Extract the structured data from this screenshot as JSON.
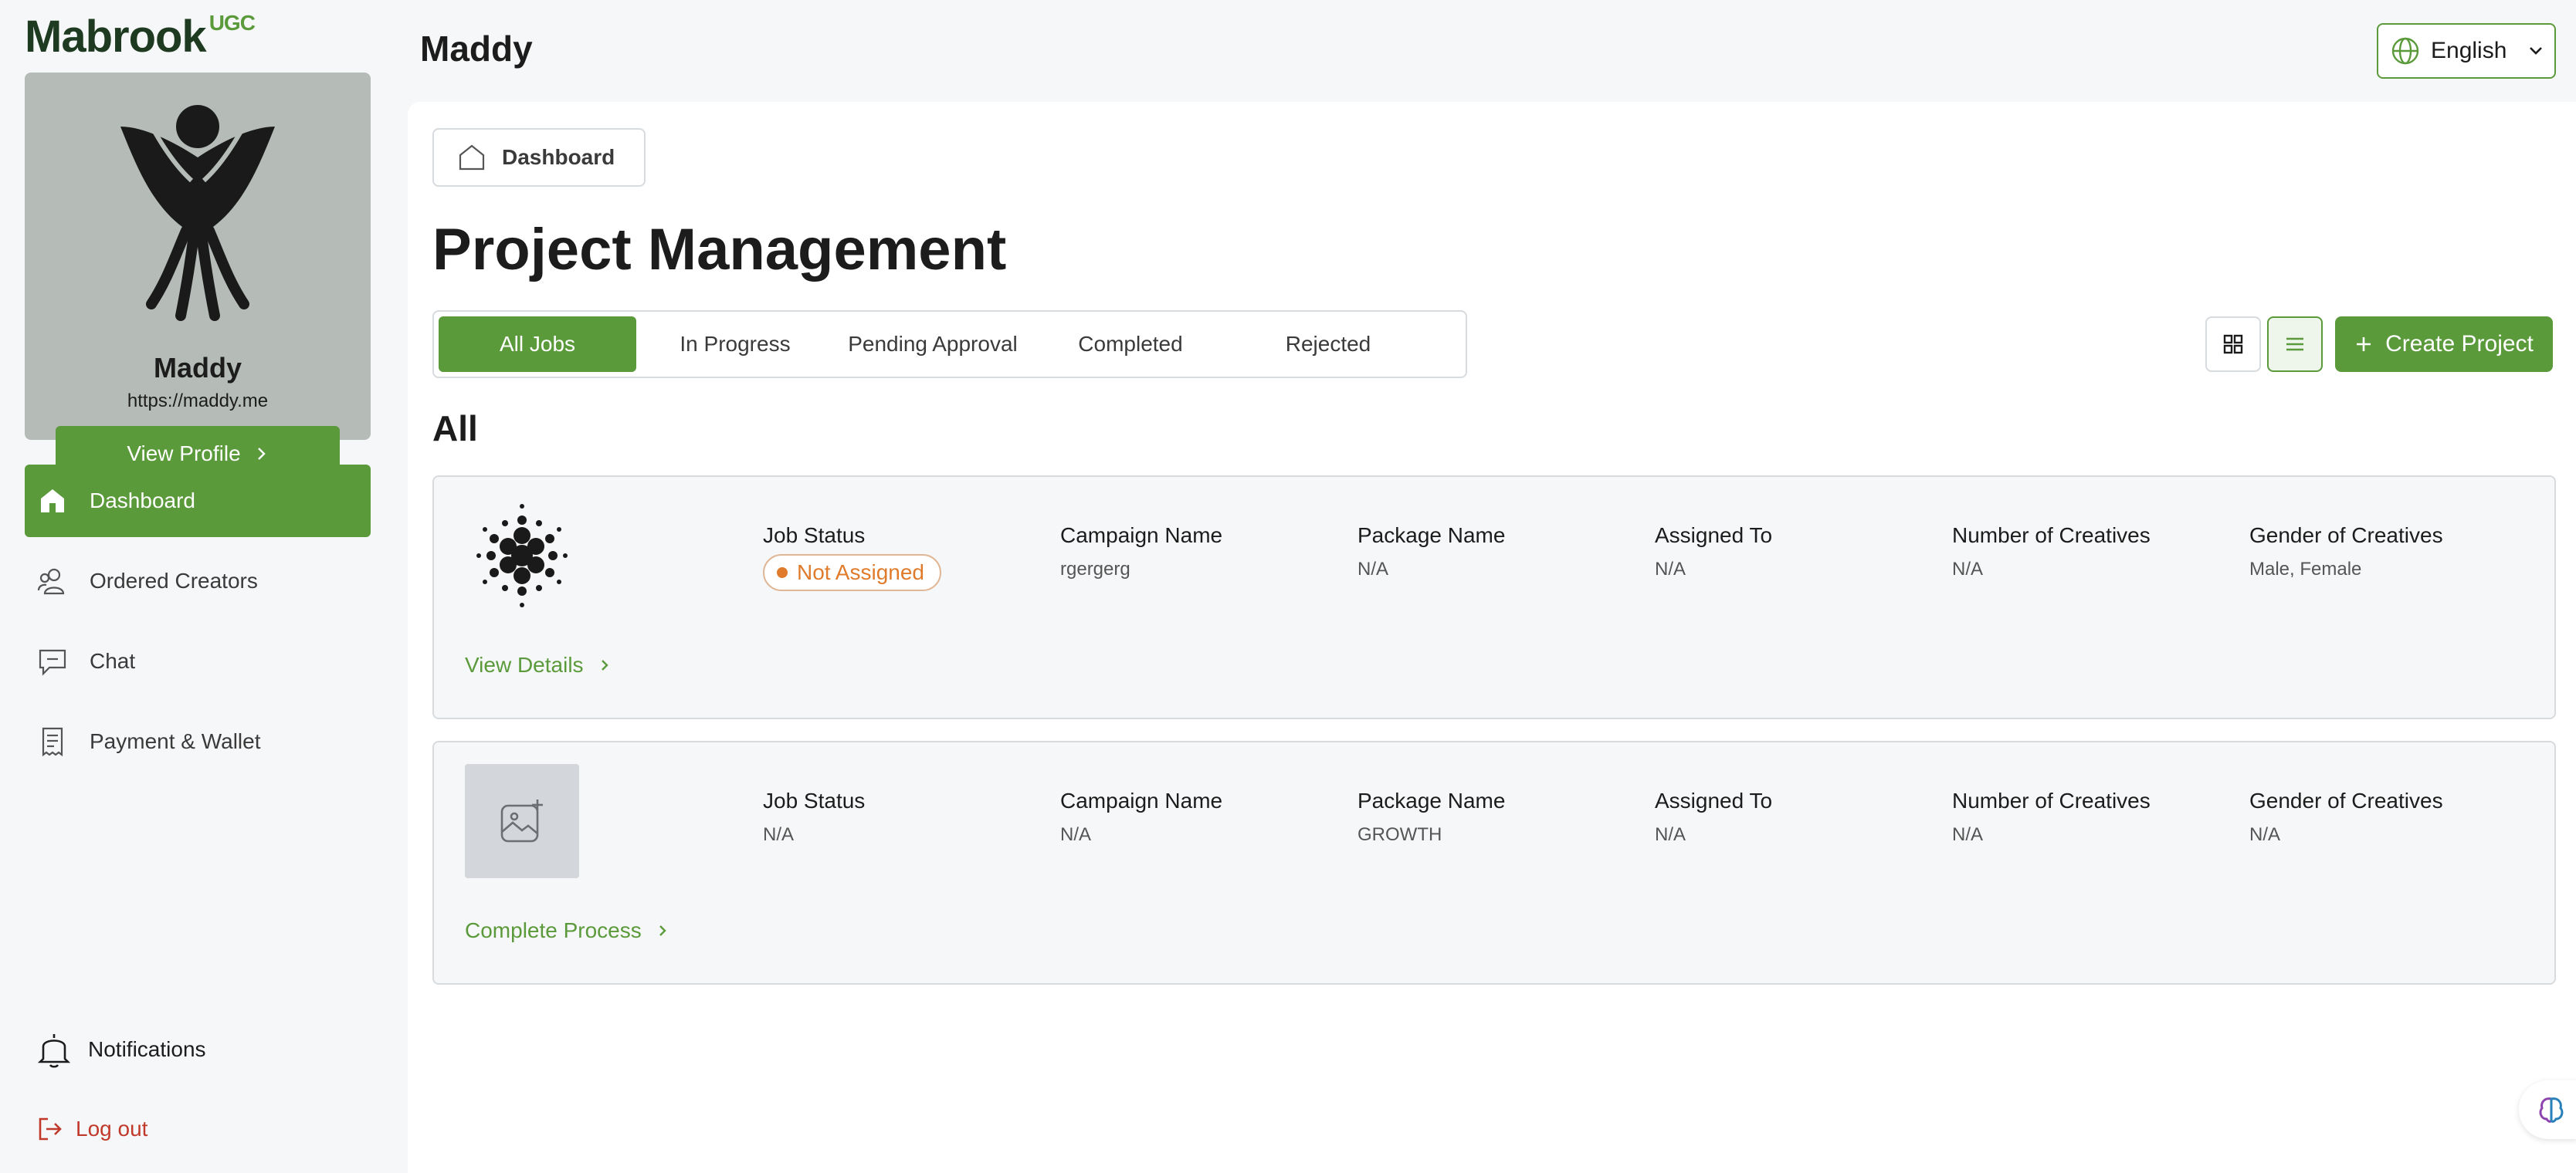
{
  "brand": {
    "name": "Mabrook",
    "badge": "UGC"
  },
  "profile": {
    "name": "Maddy",
    "url": "https://maddy.me",
    "view_profile_label": "View Profile"
  },
  "nav": {
    "items": [
      {
        "label": "Dashboard",
        "icon": "home-icon",
        "active": true
      },
      {
        "label": "Ordered Creators",
        "icon": "users-icon"
      },
      {
        "label": "Chat",
        "icon": "chat-icon"
      },
      {
        "label": "Payment & Wallet",
        "icon": "receipt-icon"
      }
    ],
    "notifications_label": "Notifications",
    "logout_label": "Log out"
  },
  "header": {
    "user": "Maddy",
    "language": "English"
  },
  "breadcrumb": {
    "label": "Dashboard"
  },
  "page": {
    "title": "Project Management",
    "section": "All",
    "create_label": "Create Project"
  },
  "tabs": [
    {
      "label": "All Jobs",
      "active": true
    },
    {
      "label": "In Progress"
    },
    {
      "label": "Pending Approval"
    },
    {
      "label": "Completed"
    },
    {
      "label": "Rejected"
    }
  ],
  "jobs": [
    {
      "job_status_label": "Job Status",
      "job_status": "Not Assigned",
      "campaign_label": "Campaign Name",
      "campaign": "rgergerg",
      "package_label": "Package Name",
      "package": "N/A",
      "assigned_label": "Assigned To",
      "assigned": "N/A",
      "creatives_label": "Number of Creatives",
      "creatives": "N/A",
      "gender_label": "Gender of Creatives",
      "gender": "Male, Female",
      "link_label": "View Details"
    },
    {
      "job_status_label": "Job Status",
      "job_status": "N/A",
      "campaign_label": "Campaign Name",
      "campaign": "N/A",
      "package_label": "Package Name",
      "package": "GROWTH",
      "assigned_label": "Assigned To",
      "assigned": "N/A",
      "creatives_label": "Number of Creatives",
      "creatives": "N/A",
      "gender_label": "Gender of Creatives",
      "gender": "N/A",
      "link_label": "Complete Process"
    }
  ],
  "colors": {
    "accent": "#5b9a3a",
    "status_orange": "#e07b2b",
    "logout_red": "#c0392b"
  }
}
